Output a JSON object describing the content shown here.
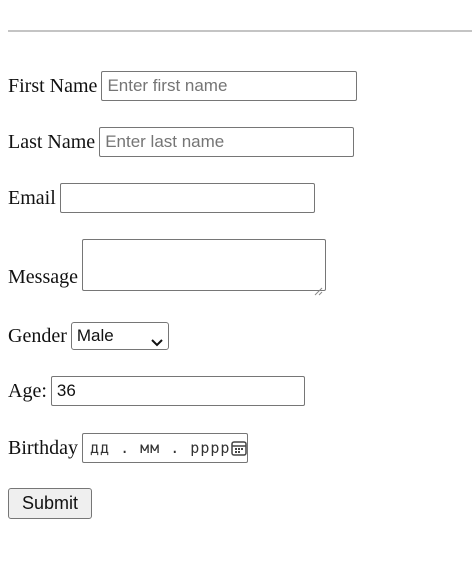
{
  "form": {
    "first_name": {
      "label": "First Name",
      "placeholder": "Enter first name",
      "value": ""
    },
    "last_name": {
      "label": "Last Name",
      "placeholder": "Enter last name",
      "value": ""
    },
    "email": {
      "label": "Email",
      "value": ""
    },
    "message": {
      "label": "Message",
      "value": ""
    },
    "gender": {
      "label": "Gender",
      "selected": "Male"
    },
    "age": {
      "label": "Age:",
      "value": "36"
    },
    "birthday": {
      "label": "Birthday",
      "placeholder": "дд . мм . рррр"
    },
    "submit_label": "Submit"
  },
  "icons": {
    "select": "chevron-down-icon",
    "date": "calendar-icon",
    "textarea": "resize-grip-icon"
  },
  "colors": {
    "border": "#767676",
    "placeholder": "#757575",
    "button_bg": "#efefef",
    "divider": "#c4c4c4"
  }
}
